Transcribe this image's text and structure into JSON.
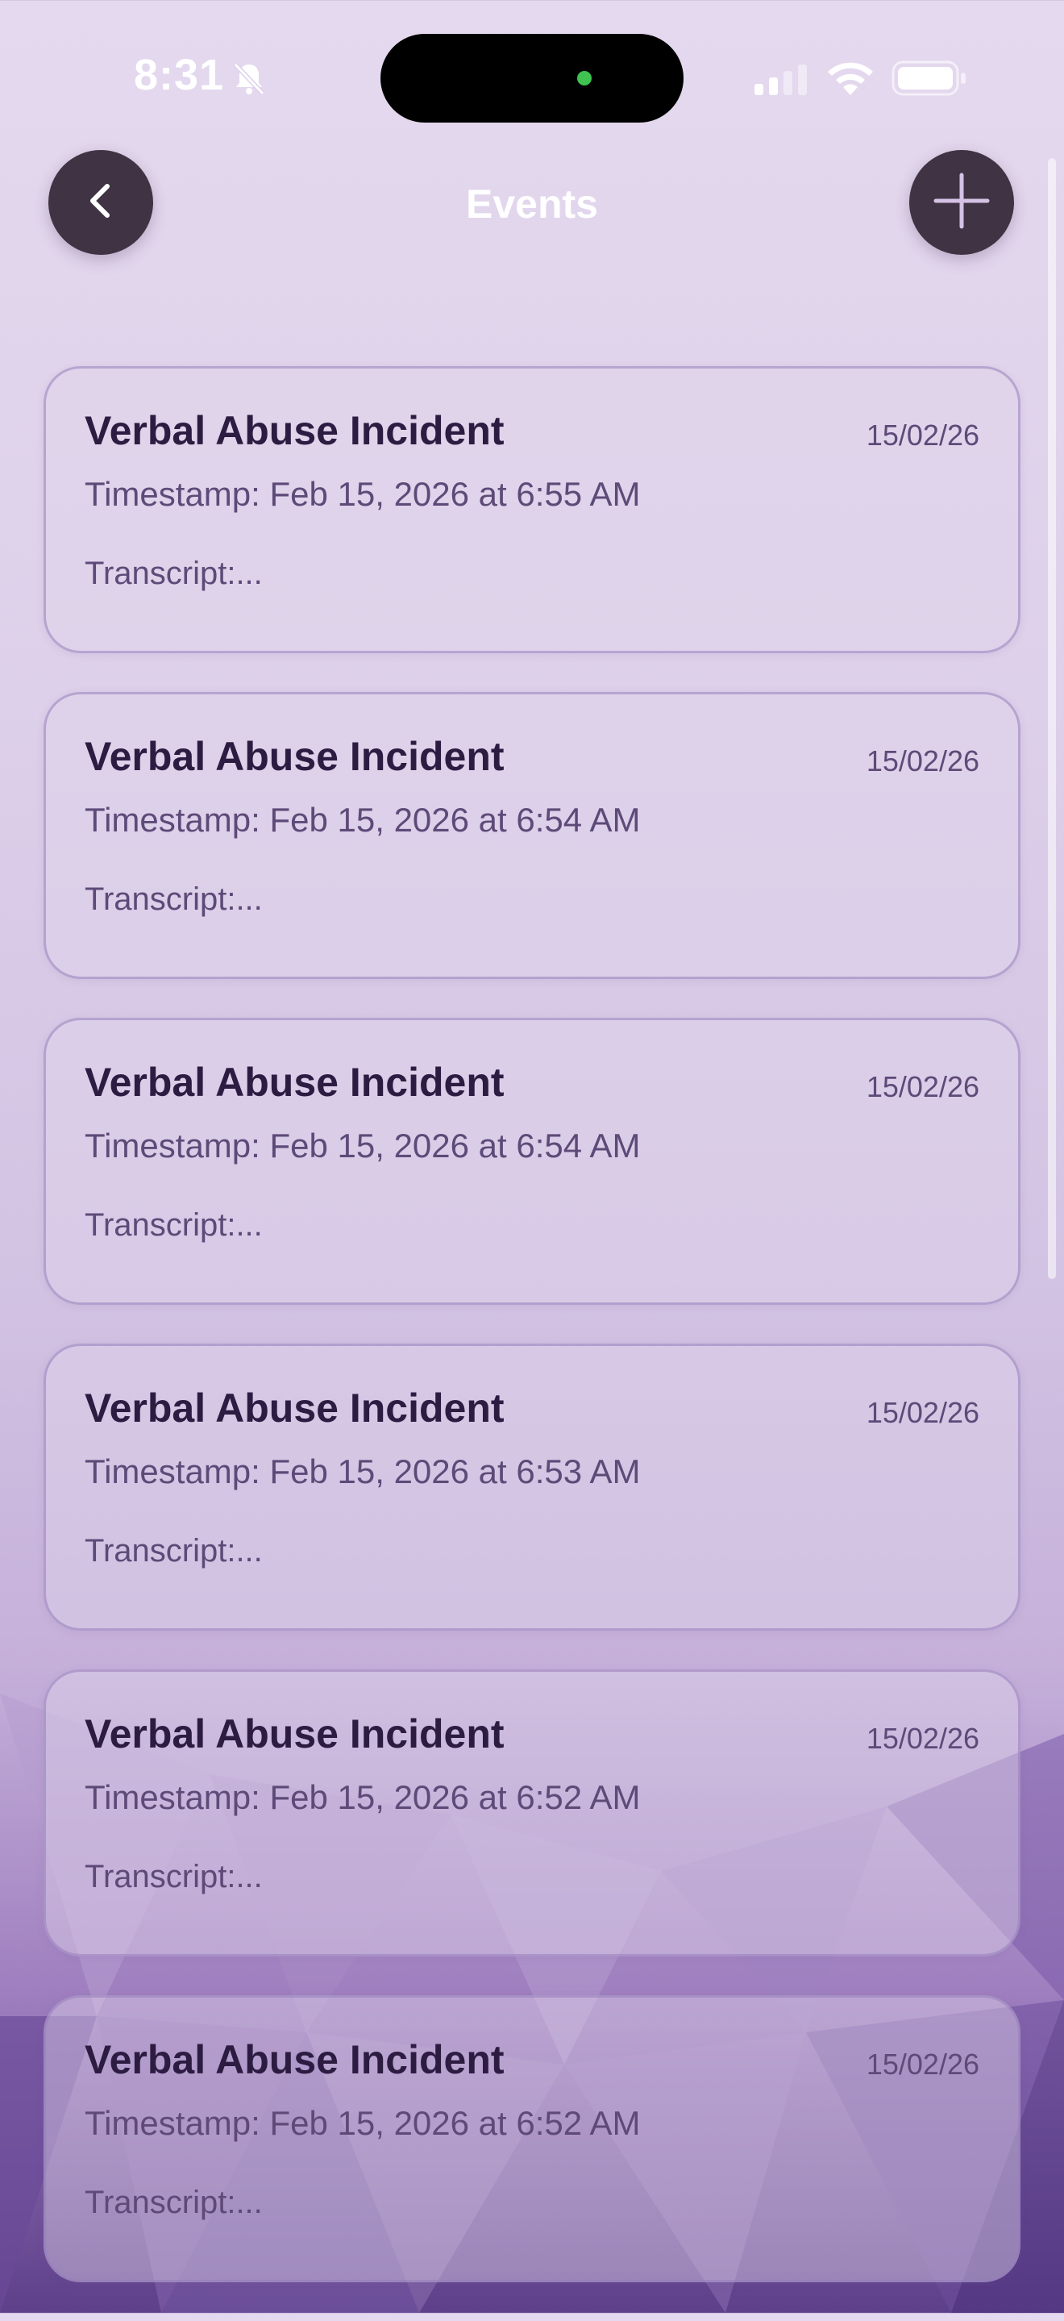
{
  "status_bar": {
    "time": "8:31",
    "icons": [
      "bell-slash-icon",
      "cellular-signal-icon",
      "wifi-icon",
      "battery-icon"
    ]
  },
  "header": {
    "title": "Events",
    "back_icon": "chevron-left-icon",
    "add_icon": "plus-icon"
  },
  "colors": {
    "button_bg": "#403444",
    "title_text": "#2d1c42",
    "secondary_text": "#5e4a78",
    "background_top": "#e4d9ee",
    "background_bottom": "#5d3f8a"
  },
  "events": [
    {
      "title": "Verbal Abuse Incident",
      "date": "15/02/26",
      "timestamp": "Timestamp: Feb 15, 2026 at 6:55 AM",
      "transcript": "Transcript:..."
    },
    {
      "title": "Verbal Abuse Incident",
      "date": "15/02/26",
      "timestamp": "Timestamp: Feb 15, 2026 at 6:54 AM",
      "transcript": "Transcript:..."
    },
    {
      "title": "Verbal Abuse Incident",
      "date": "15/02/26",
      "timestamp": "Timestamp: Feb 15, 2026 at 6:54 AM",
      "transcript": "Transcript:..."
    },
    {
      "title": "Verbal Abuse Incident",
      "date": "15/02/26",
      "timestamp": "Timestamp: Feb 15, 2026 at 6:53 AM",
      "transcript": "Transcript:..."
    },
    {
      "title": "Verbal Abuse Incident",
      "date": "15/02/26",
      "timestamp": "Timestamp: Feb 15, 2026 at 6:52 AM",
      "transcript": "Transcript:..."
    },
    {
      "title": "Verbal Abuse Incident",
      "date": "15/02/26",
      "timestamp": "Timestamp: Feb 15, 2026 at 6:52 AM",
      "transcript": "Transcript:..."
    }
  ]
}
